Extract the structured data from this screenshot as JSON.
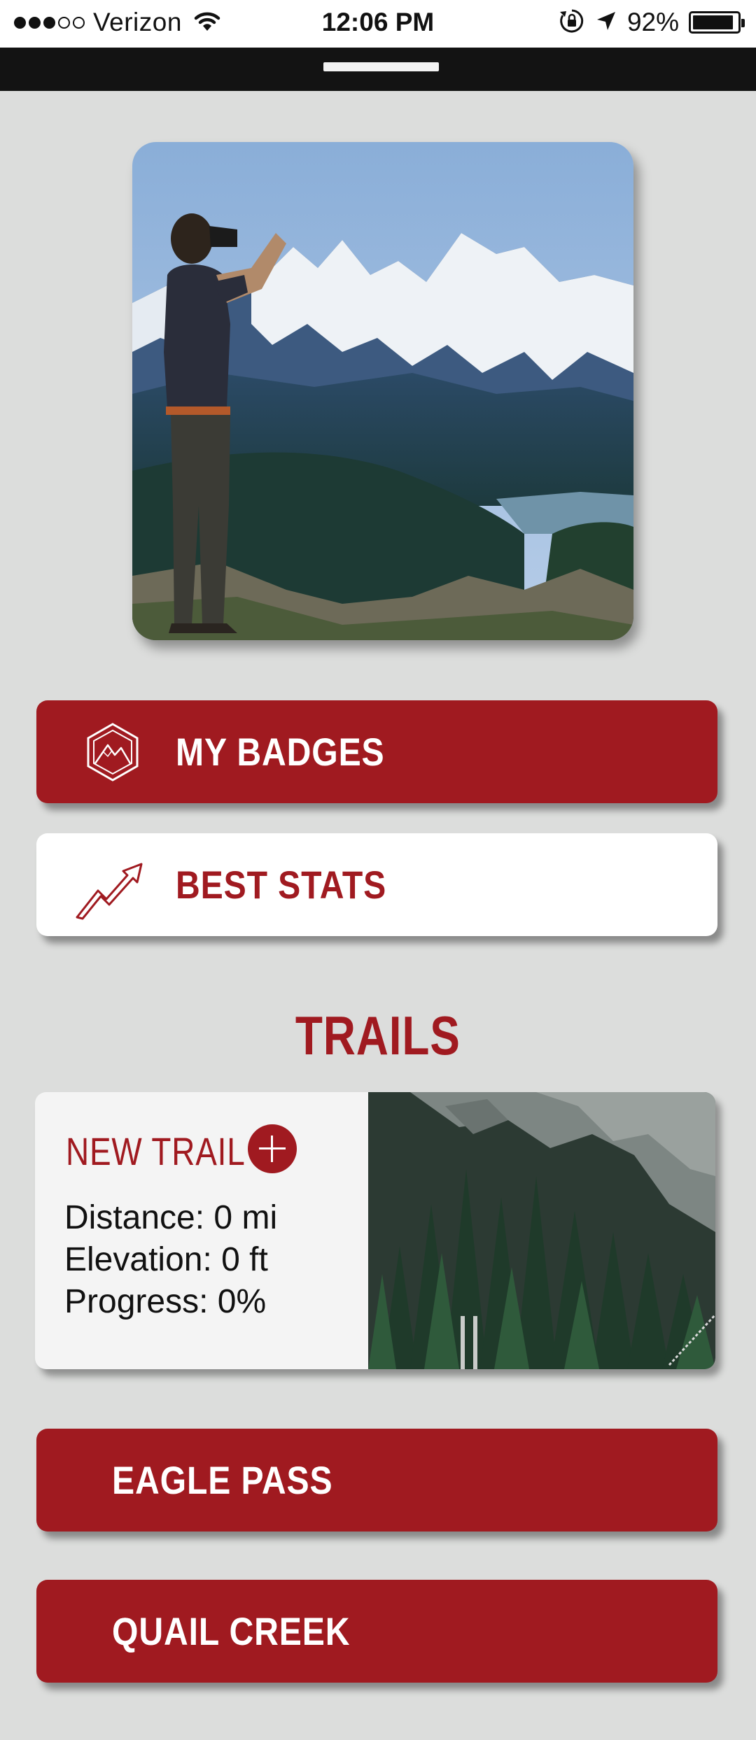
{
  "status_bar": {
    "carrier": "Verizon",
    "time": "12:06 PM",
    "battery": "92%",
    "battery_level": 0.92,
    "icons": [
      "signal-dots-icon",
      "wifi-icon",
      "orientation-lock-icon",
      "location-arrow-icon",
      "battery-icon"
    ]
  },
  "menu": {
    "badges_label": "MY BADGES",
    "badges_icon": "mountain-badge-icon",
    "stats_label": "BEST STATS",
    "stats_icon": "trend-arrow-icon"
  },
  "trails": {
    "section_title": "TRAILS",
    "new_trail": {
      "title": "NEW TRAIL",
      "add_icon": "plus-circle-icon",
      "distance": "Distance: 0 mi",
      "elevation": "Elevation: 0 ft",
      "progress": "Progress: 0%"
    },
    "items": [
      {
        "label": "EAGLE PASS"
      },
      {
        "label": "QUAIL CREEK"
      }
    ]
  },
  "colors": {
    "accent": "#a01a20",
    "background": "#dcdddc",
    "top_bar": "#131313"
  }
}
